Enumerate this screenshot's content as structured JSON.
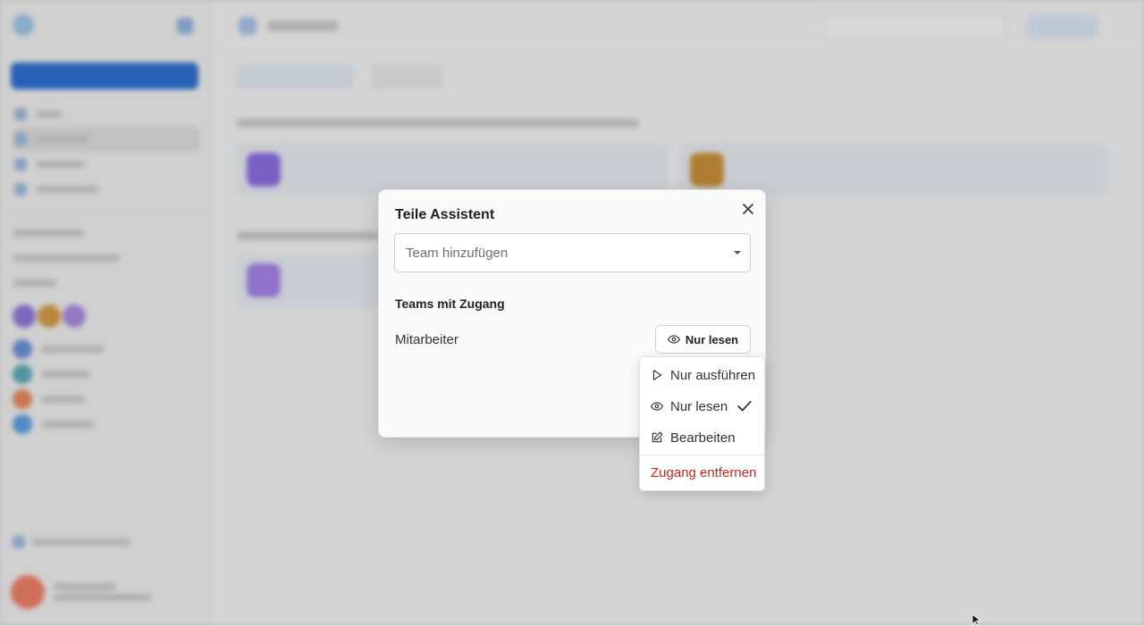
{
  "dialog": {
    "title": "Teile Assistent",
    "team_placeholder": "Team hinzufügen",
    "section_label": "Teams mit Zugang",
    "member": {
      "name": "Mitarbeiter",
      "permission": "Nur lesen"
    }
  },
  "permission_menu": {
    "items": [
      {
        "label": "Nur ausführen",
        "icon": "play-icon"
      },
      {
        "label": "Nur lesen",
        "icon": "eye-icon",
        "selected": true
      },
      {
        "label": "Bearbeiten",
        "icon": "edit-icon"
      }
    ],
    "remove_label": "Zugang entfernen"
  },
  "colors": {
    "accent": "#2f6fd1",
    "danger": "#c0261f"
  }
}
